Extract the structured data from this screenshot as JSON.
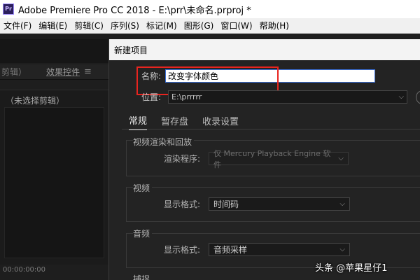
{
  "window": {
    "app_icon": "Pr",
    "title": "Adobe Premiere Pro CC 2018 - E:\\prr\\未命名.prproj *"
  },
  "menubar": [
    "文件(F)",
    "编辑(E)",
    "剪辑(C)",
    "序列(S)",
    "标记(M)",
    "图形(G)",
    "窗口(W)",
    "帮助(H)"
  ],
  "left_panel": {
    "tab_clip": "剪辑）",
    "tab_effects": "效果控件",
    "menu_icon": "≡",
    "no_clip": "（未选择剪辑）",
    "timecode": "00:00:00:00"
  },
  "dialog": {
    "title": "新建项目",
    "name_label": "名称:",
    "name_value": "改变字体颜色",
    "location_label": "位置:",
    "location_value": "E:\\prrrrr",
    "tabs": [
      "常规",
      "暂存盘",
      "收录设置"
    ],
    "video_render": {
      "title": "视频渲染和回放",
      "renderer_label": "渲染程序:",
      "renderer_value": "仅 Mercury Playback Engine 软件"
    },
    "video": {
      "title": "视频",
      "format_label": "显示格式:",
      "format_value": "时间码"
    },
    "audio": {
      "title": "音频",
      "format_label": "显示格式:",
      "format_value": "音频采样"
    },
    "capture": {
      "title": "捕捉"
    }
  },
  "watermark": "头条 @苹果星仔1",
  "colors": {
    "highlight": "#e8241f",
    "dialog_bg": "#232323"
  },
  "icons": [
    "premiere-pro-icon",
    "panel-menu-icon",
    "chevron-down-icon",
    "browse-circle-icon"
  ]
}
